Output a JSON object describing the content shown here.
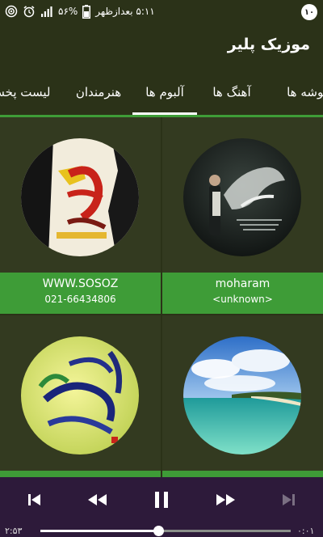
{
  "status_bar": {
    "notification_count": "۱۰",
    "time": "۵:۱۱ بعدازظهر",
    "battery": "۵۶%"
  },
  "app": {
    "title": "موزیک پلیر"
  },
  "tabs": [
    {
      "label": "پوشه ها",
      "selected": false
    },
    {
      "label": "آهنگ ها",
      "selected": false
    },
    {
      "label": "آلبوم ها",
      "selected": true
    },
    {
      "label": "هنرمندان",
      "selected": false
    },
    {
      "label": "لیست پخش",
      "selected": false
    }
  ],
  "albums": [
    {
      "title": "moharam",
      "artist": "<unknown>",
      "art_icon": "moharam-cover"
    },
    {
      "title": "WWW.SOSOZ",
      "artist": "021-66434806",
      "art_icon": "calligraphy-cover"
    },
    {
      "title": "",
      "artist": "",
      "art_icon": "beach-cover"
    },
    {
      "title": "",
      "artist": "",
      "art_icon": "green-calligraphy-cover"
    }
  ],
  "player": {
    "elapsed": "۰:۰۱",
    "total": "۲:۵۳",
    "progress": 0.47,
    "controls": [
      "skip-previous-icon",
      "rewind-icon",
      "pause-icon",
      "fast-forward-icon",
      "skip-next-icon"
    ]
  },
  "colors": {
    "bar": "#2b3218",
    "card": "#333a20",
    "accent_green": "#3e9c37",
    "player_bg": "#2d1a3a"
  }
}
